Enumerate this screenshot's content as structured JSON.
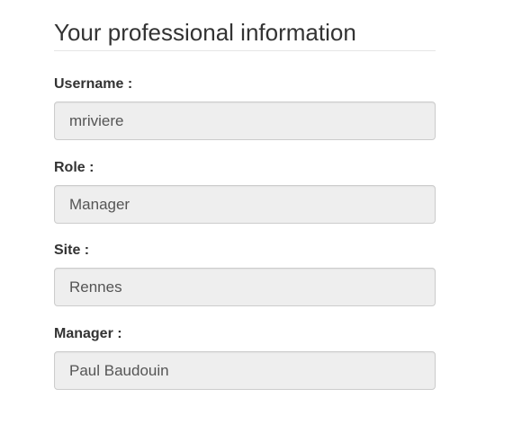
{
  "section": {
    "title": "Your professional information"
  },
  "fields": {
    "username": {
      "label": "Username :",
      "value": "mriviere"
    },
    "role": {
      "label": "Role :",
      "value": "Manager"
    },
    "site": {
      "label": "Site :",
      "value": "Rennes"
    },
    "manager": {
      "label": "Manager :",
      "value": "Paul Baudouin"
    }
  }
}
